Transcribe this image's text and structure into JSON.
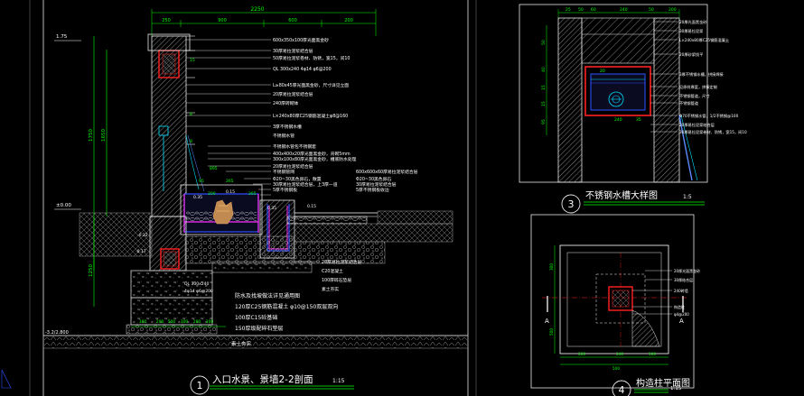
{
  "drawing1": {
    "number": "1",
    "title": "入口水景、景墙2-2剖面",
    "scale": "1:15",
    "top_dims": [
      "2250",
      "250",
      "900",
      "600",
      "200"
    ],
    "left_dims": [
      "1750",
      "1650",
      "1250"
    ],
    "elev_labels": [
      "1.75",
      "±0.00",
      "-0.32",
      "-0.17",
      "0.35",
      "0.15",
      "0.35",
      "0.15",
      "0.10",
      "0.22",
      "0.13",
      "0.15",
      "0.20",
      "0.10",
      "0.31",
      "0.4"
    ],
    "bottom_dims": [
      "300",
      "200",
      "500",
      "300",
      "200",
      "300"
    ],
    "side_dims": [
      "15",
      "8",
      "8"
    ],
    "dim_labels": [
      "895",
      "95",
      "265",
      "265",
      "200",
      "350",
      "250",
      "300",
      "100",
      "130",
      "200"
    ],
    "notes_right": [
      "600x350x100厚光面黑金砂",
      "30厚易拉泥浆结合层",
      "50厚易拉泥浆卷材、防锈，宽15，间10",
      "QL 300x240 4φ14 φ6@200",
      "L≥80x45厚光面黑金砂，尺寸详见立面",
      "20厚易拉泥浆结合层",
      "240厚砖砌体",
      "L×240x80厚C25钢筋混凝土φ8@160",
      "3厚不锈钢水槽",
      "不锈钢水管",
      "不锈钢水管包不锈钢套",
      "400x400x20厚光面黑金砂，背砌5mm",
      "300x100x80厚光面黑金砂，槽底防水处理",
      "20厚易拉泥浆结合层",
      "不锈钢管网",
      "Φ20~30黑色卵石，散置",
      "30厚易拉泥浆结合层，上3厚一道",
      "5厚不锈钢板"
    ],
    "notes_mid": [
      "600x600x60厚易拉泥浆结合层",
      "Φ20~30黑色卵石",
      "30厚易拉泥浆结合层",
      "5厚不锈钢板收边"
    ],
    "notes_low": [
      "20厚易拉泥浆结合层",
      "C20混凝土",
      "100厚碎石垫层",
      "素土夯实"
    ],
    "wall_labels": [
      "QL 300x240",
      "4φ14 φ6@200"
    ],
    "foundation_notes": [
      "防水及找坡做法详见通用图",
      "120厚C25钢筋混凝土 φ10@150双层双向",
      "100厚C15砼基础",
      "150厚级配碎石垫层",
      "素土夯实"
    ],
    "ground_label": "素土夯实",
    "bottom_elev": "-3.2/2.800"
  },
  "drawing3": {
    "number": "3",
    "title": "不锈钢水槽大样图",
    "scale": "1:5",
    "top_dims": [
      "25",
      "50",
      "60",
      "240",
      "50",
      "200"
    ],
    "notes": [
      "20厚光面黑金砂",
      "30厚易拉泥浆",
      "L×240x80厚C25钢筋混凝土",
      "20厚砂浆找平",
      "3厚不锈钢水槽，拼接焊接",
      "见原样厚度，拼接定制",
      "不锈钢管道，尺寸",
      "不锈钢管道",
      "Φ70不锈钢水管，1/2不锈钢@100",
      "20厚易拉泥浆结合层",
      "30厚易拉泥浆卷材、防锈，宽15，间10"
    ],
    "side_dims": [
      "50",
      "40",
      "15",
      "15",
      "95"
    ],
    "inner_dims": [
      "20",
      "240",
      "35"
    ]
  },
  "drawing4": {
    "number": "4",
    "title": "构造柱平面图",
    "scale": "1:15",
    "section_marks": [
      "A",
      "A"
    ],
    "dims_bottom": [
      "200",
      "240",
      "100",
      "500"
    ],
    "dims_left": [
      "300",
      "500"
    ],
    "notes": [
      "20厚光面黑金砂",
      "30厚结合层",
      "240砖墙",
      "构造柱",
      "φ4@200"
    ]
  },
  "colors": {
    "background": "#000000",
    "frame": "#e8e8e8",
    "dim": "#00ff00",
    "note": "#ffffff",
    "text_yellow": "#ffff00",
    "red": "#ff2020",
    "cyan": "#00e0ff",
    "magenta": "#ff30ff",
    "blue": "#3050ff",
    "gray": "#8a8a8a"
  }
}
